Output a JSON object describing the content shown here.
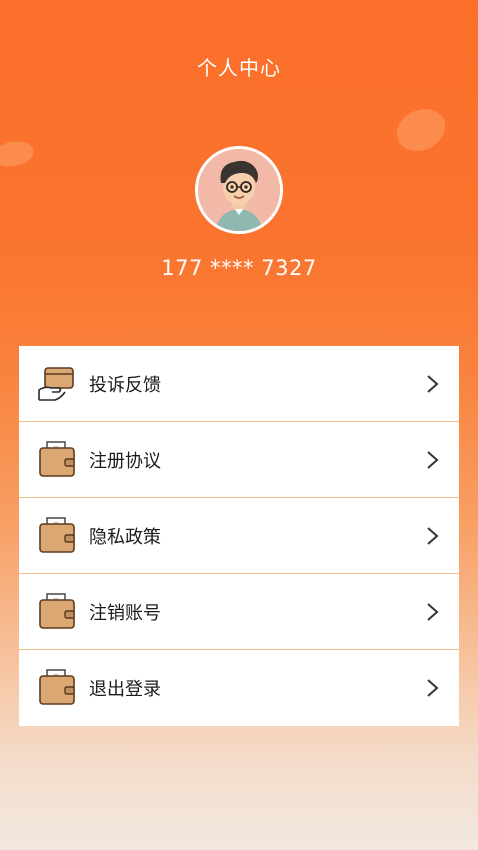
{
  "header": {
    "title": "个人中心"
  },
  "profile": {
    "avatar_icon": "cartoon-avatar-boy-glasses",
    "phone": "177 **** 7327"
  },
  "menu": {
    "items": [
      {
        "label": "投诉反馈",
        "icon": "hand-card-icon"
      },
      {
        "label": "注册协议",
        "icon": "wallet-icon"
      },
      {
        "label": "隐私政策",
        "icon": "wallet-icon"
      },
      {
        "label": "注销账号",
        "icon": "wallet-icon"
      },
      {
        "label": "退出登录",
        "icon": "wallet-icon"
      }
    ]
  },
  "colors": {
    "accent": "#fb6f2a",
    "divider": "#f4c08e",
    "icon_fill": "#dba874"
  }
}
